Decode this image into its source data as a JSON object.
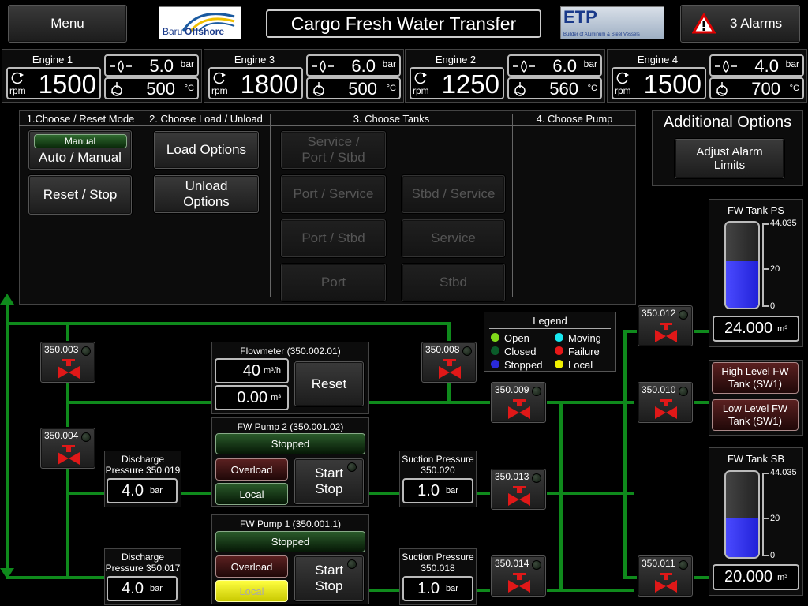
{
  "header": {
    "menu_label": "Menu",
    "title": "Cargo Fresh Water Transfer",
    "logo_left_1": "Baru",
    "logo_left_2": "Offshore",
    "logo_right_1": "ETP",
    "logo_right_2": "Builder of Aluminum & Steel Vessels",
    "alarms_label": "3 Alarms"
  },
  "engines": [
    {
      "name": "Engine 1",
      "rpm": "1500",
      "rpm_unit": "rpm",
      "pressure": "5.0",
      "pressure_unit": "bar",
      "temp": "500",
      "temp_unit": "°C"
    },
    {
      "name": "Engine 3",
      "rpm": "1800",
      "rpm_unit": "rpm",
      "pressure": "6.0",
      "pressure_unit": "bar",
      "temp": "500",
      "temp_unit": "°C"
    },
    {
      "name": "Engine 2",
      "rpm": "1250",
      "rpm_unit": "rpm",
      "pressure": "6.0",
      "pressure_unit": "bar",
      "temp": "560",
      "temp_unit": "°C"
    },
    {
      "name": "Engine 4",
      "rpm": "1500",
      "rpm_unit": "rpm",
      "pressure": "4.0",
      "pressure_unit": "bar",
      "temp": "700",
      "temp_unit": "°C"
    }
  ],
  "steps": {
    "mode_header": "1.Choose / Reset Mode",
    "load_header": "2. Choose Load / Unload",
    "tanks_header": "3. Choose Tanks",
    "pump_header": "4. Choose Pump",
    "manual_indicator": "Manual",
    "auto_manual": "Auto / Manual",
    "reset_stop": "Reset / Stop",
    "load_options": "Load Options",
    "unload_options": "Unload Options",
    "tank_service_port_stbd": "Service / Port / Stbd",
    "tank_port_service": "Port / Service",
    "tank_stbd_service": "Stbd / Service",
    "tank_port_stbd": "Port / Stbd",
    "tank_service": "Service",
    "tank_port": "Port",
    "tank_stbd": "Stbd"
  },
  "additional": {
    "title": "Additional Options",
    "adjust_alarm": "Adjust Alarm Limits"
  },
  "legend": {
    "title": "Legend",
    "open": "Open",
    "moving": "Moving",
    "closed": "Closed",
    "failure": "Failure",
    "stopped": "Stopped",
    "local": "Local"
  },
  "valves": {
    "v003": "350.003",
    "v004": "350.004",
    "v008": "350.008",
    "v009": "350.009",
    "v010": "350.010",
    "v011": "350.011",
    "v012": "350.012",
    "v013": "350.013",
    "v014": "350.014"
  },
  "flowmeter": {
    "title": "Flowmeter (350.002.01)",
    "rate": "40",
    "rate_unit": "m³/h",
    "total": "0.00",
    "total_unit": "m³",
    "reset": "Reset"
  },
  "pump2": {
    "title": "FW Pump 2 (350.001.02)",
    "status": "Stopped",
    "overload": "Overload",
    "local": "Local",
    "start": "Start",
    "stop": "Stop"
  },
  "pump1": {
    "title": "FW Pump 1 (350.001.1)",
    "status": "Stopped",
    "overload": "Overload",
    "local": "Local",
    "start": "Start",
    "stop": "Stop"
  },
  "discharge2": {
    "title1": "Discharge",
    "title2": "Pressure 350.019",
    "value": "4.0",
    "unit": "bar"
  },
  "discharge1": {
    "title1": "Discharge",
    "title2": "Pressure 350.017",
    "value": "4.0",
    "unit": "bar"
  },
  "suction2": {
    "title1": "Suction Pressure",
    "title2": "350.020",
    "value": "1.0",
    "unit": "bar"
  },
  "suction1": {
    "title1": "Suction Pressure",
    "title2": "350.018",
    "value": "1.0",
    "unit": "bar"
  },
  "tank_ps": {
    "title": "FW Tank PS",
    "tick_max": "44.035",
    "tick_mid": "20",
    "tick_min": "0",
    "level_fraction": 0.545,
    "volume": "24.000",
    "unit": "m³"
  },
  "tank_sb": {
    "title": "FW Tank SB",
    "tick_max": "44.035",
    "tick_mid": "20",
    "tick_min": "0",
    "level_fraction": 0.454,
    "volume": "20.000",
    "unit": "m³"
  },
  "level_alarms": {
    "high": "High Level FW Tank (SW1)",
    "low": "Low Level FW Tank (SW1)"
  },
  "colors": {
    "pipe": "#0f8a1c",
    "valve_red": "#e01818",
    "tank_fill": "#2d2df0",
    "local_yellow": "#f0f000"
  }
}
